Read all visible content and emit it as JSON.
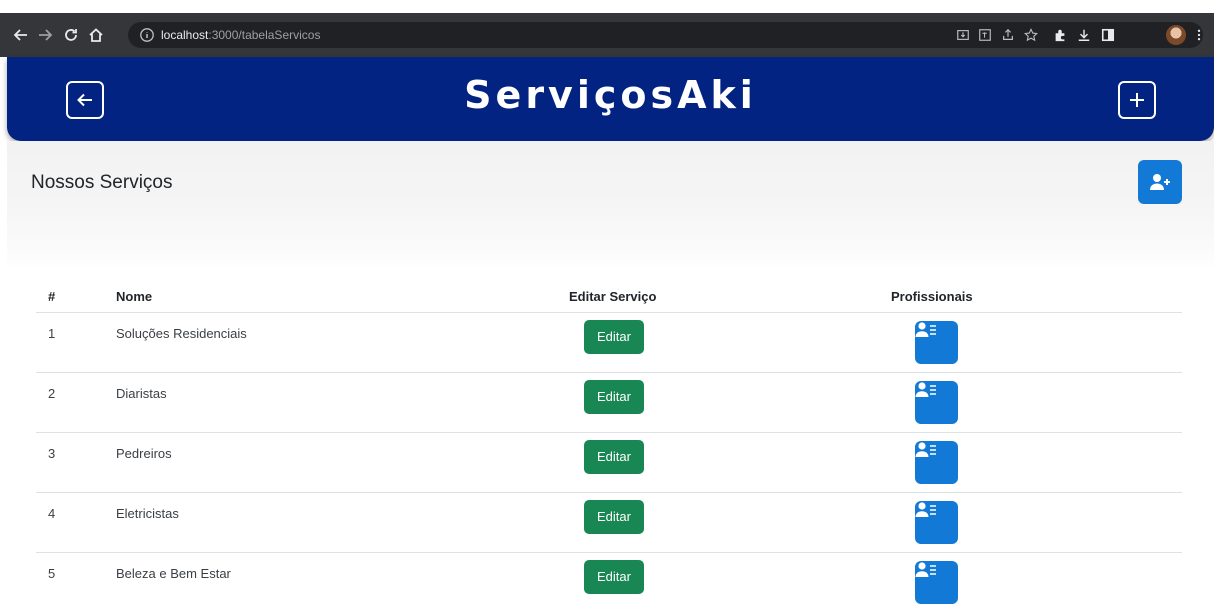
{
  "browser": {
    "url_host": "localhost",
    "url_path": ":3000/tabelaServicos"
  },
  "header": {
    "brand": "ServiçosAki",
    "back_icon": "arrow-left-square-icon",
    "add_icon": "plus-square-icon"
  },
  "section": {
    "title": "Nossos Serviços",
    "add_user_icon": "person-plus-icon"
  },
  "table": {
    "columns": [
      "#",
      "Nome",
      "Editar Serviço",
      "Profissionais"
    ],
    "rows": [
      {
        "id": "1",
        "name": "Soluções Residenciais",
        "edit_label": "Editar"
      },
      {
        "id": "2",
        "name": "Diaristas",
        "edit_label": "Editar"
      },
      {
        "id": "3",
        "name": "Pedreiros",
        "edit_label": "Editar"
      },
      {
        "id": "4",
        "name": "Eletricistas",
        "edit_label": "Editar"
      },
      {
        "id": "5",
        "name": "Beleza e Bem Estar",
        "edit_label": "Editar"
      }
    ],
    "professionals_icon": "person-list-icon"
  },
  "colors": {
    "header_bg": "#022381",
    "edit_button": "#198754",
    "primary_button": "#1279d6"
  }
}
